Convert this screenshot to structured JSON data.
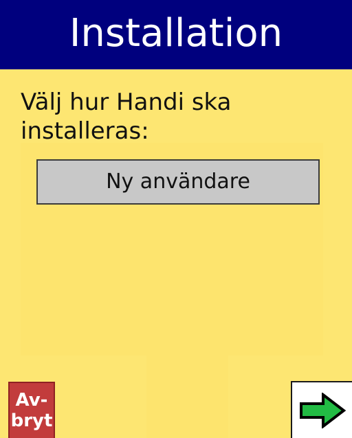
{
  "header": {
    "title": "Installation"
  },
  "prompt": {
    "text": "Välj hur Handi ska\ninstalleras:"
  },
  "options": {
    "new_user_label": "Ny användare"
  },
  "footer": {
    "cancel_line1": "Av-",
    "cancel_line2": "bryt",
    "next_icon": "right-arrow-icon"
  },
  "colors": {
    "header_background": "#00007e",
    "page_background": "#fde672",
    "cancel_background": "#c23c3c",
    "arrow_fill": "#22bb44"
  }
}
